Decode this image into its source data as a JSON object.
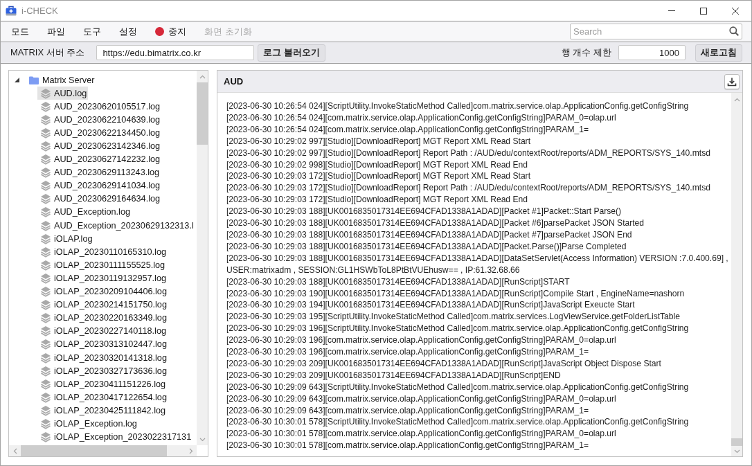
{
  "window": {
    "title": "i-CHECK"
  },
  "menu": [
    {
      "label": "모드",
      "kind": "menu",
      "disabled": false
    },
    {
      "label": "파일",
      "kind": "menu",
      "disabled": false
    },
    {
      "label": "도구",
      "kind": "menu",
      "disabled": false
    },
    {
      "label": "설정",
      "kind": "menu",
      "disabled": false
    },
    {
      "label": "중지",
      "kind": "action",
      "disabled": false
    },
    {
      "label": "화면 초기화",
      "kind": "menu",
      "disabled": true
    }
  ],
  "search": {
    "placeholder": "Search"
  },
  "toolbar": {
    "server_label": "MATRIX 서버 주소",
    "server_url": "https://edu.bimatrix.co.kr",
    "load_button": "로그 불러오기",
    "row_limit_label": "행 개수 제한",
    "row_limit": "1000",
    "refresh_button": "새로고침"
  },
  "tree": [
    {
      "label": "Matrix Server",
      "expanded": true,
      "selected": false,
      "children": [
        {
          "label": "AUD.log",
          "selected": true
        },
        {
          "label": "AUD_20230620105517.log",
          "selected": false
        },
        {
          "label": "AUD_20230622104639.log",
          "selected": false
        },
        {
          "label": "AUD_20230622134450.log",
          "selected": false
        },
        {
          "label": "AUD_20230623142346.log",
          "selected": false
        },
        {
          "label": "AUD_20230627142232.log",
          "selected": false
        },
        {
          "label": "AUD_20230629113243.log",
          "selected": false
        },
        {
          "label": "AUD_20230629141034.log",
          "selected": false
        },
        {
          "label": "AUD_20230629164634.log",
          "selected": false
        },
        {
          "label": "AUD_Exception.log",
          "selected": false
        },
        {
          "label": "AUD_Exception_20230629132313.l",
          "selected": false
        },
        {
          "label": "iOLAP.log",
          "selected": false
        },
        {
          "label": "iOLAP_20230110165310.log",
          "selected": false
        },
        {
          "label": "iOLAP_20230111155525.log",
          "selected": false
        },
        {
          "label": "iOLAP_20230119132957.log",
          "selected": false
        },
        {
          "label": "iOLAP_20230209104406.log",
          "selected": false
        },
        {
          "label": "iOLAP_20230214151750.log",
          "selected": false
        },
        {
          "label": "iOLAP_20230220163349.log",
          "selected": false
        },
        {
          "label": "iOLAP_20230227140118.log",
          "selected": false
        },
        {
          "label": "iOLAP_20230313102447.log",
          "selected": false
        },
        {
          "label": "iOLAP_20230320141318.log",
          "selected": false
        },
        {
          "label": "iOLAP_20230327173636.log",
          "selected": false
        },
        {
          "label": "iOLAP_20230411151226.log",
          "selected": false
        },
        {
          "label": "iOLAP_20230417122654.log",
          "selected": false
        },
        {
          "label": "iOLAP_20230425111842.log",
          "selected": false
        },
        {
          "label": "iOLAP_Exception.log",
          "selected": false
        },
        {
          "label": "iOLAP_Exception_2023022317131",
          "selected": false
        }
      ]
    }
  ],
  "log_panel": {
    "title": "AUD",
    "lines": [
      "[2023-06-30 10:26:54 024][ScriptUtility.InvokeStaticMethod Called]com.matrix.service.olap.ApplicationConfig.getConfigString",
      "[2023-06-30 10:26:54 024][com.matrix.service.olap.ApplicationConfig.getConfigString]PARAM_0=olap.url",
      "[2023-06-30 10:26:54 024][com.matrix.service.olap.ApplicationConfig.getConfigString]PARAM_1=",
      "[2023-06-30 10:29:02 997][Studio][DownloadReport] MGT Report XML Read Start",
      "[2023-06-30 10:29:02 997][Studio][DownloadReport] Report Path : /AUD/edu/contextRoot/reports/ADM_REPORTS/SYS_140.mtsd",
      "[2023-06-30 10:29:02 998][Studio][DownloadReport] MGT Report XML Read End",
      "[2023-06-30 10:29:03 172][Studio][DownloadReport] MGT Report XML Read Start",
      "[2023-06-30 10:29:03 172][Studio][DownloadReport] Report Path : /AUD/edu/contextRoot/reports/ADM_REPORTS/SYS_140.mtsd",
      "[2023-06-30 10:29:03 172][Studio][DownloadReport] MGT Report XML Read End",
      "[2023-06-30 10:29:03 188][UK0016835017314EE694CFAD1338A1ADAD][Packet #1]Packet::Start Parse()",
      "[2023-06-30 10:29:03 188][UK0016835017314EE694CFAD1338A1ADAD][Packet #6]parsePacket JSON Started",
      "[2023-06-30 10:29:03 188][UK0016835017314EE694CFAD1338A1ADAD][Packet #7]parsePacket JSON End",
      "[2023-06-30 10:29:03 188][UK0016835017314EE694CFAD1338A1ADAD][Packet.Parse()]Parse Completed",
      "[2023-06-30 10:29:03 188][UK0016835017314EE694CFAD1338A1ADAD][DataSetServlet(Access Information) VERSION :7.0.400.69] , USER:matrixadm , SESSION:GL1HSWbToL8PtBtVUEhusw== , IP:61.32.68.66",
      "[2023-06-30 10:29:03 188][UK0016835017314EE694CFAD1338A1ADAD][RunScript]START",
      "[2023-06-30 10:29:03 190][UK0016835017314EE694CFAD1338A1ADAD][RunScript]Compile Start , EngineName=nashorn",
      "[2023-06-30 10:29:03 194][UK0016835017314EE694CFAD1338A1ADAD][RunScript]JavaScript Exeucte Start",
      "[2023-06-30 10:29:03 195][ScriptUtility.InvokeStaticMethod Called]com.matrix.services.LogViewService.getFolderListTable",
      "[2023-06-30 10:29:03 196][ScriptUtility.InvokeStaticMethod Called]com.matrix.service.olap.ApplicationConfig.getConfigString",
      "[2023-06-30 10:29:03 196][com.matrix.service.olap.ApplicationConfig.getConfigString]PARAM_0=olap.url",
      "[2023-06-30 10:29:03 196][com.matrix.service.olap.ApplicationConfig.getConfigString]PARAM_1=",
      "[2023-06-30 10:29:03 209][UK0016835017314EE694CFAD1338A1ADAD][RunScript]JavaScript Object Dispose Start",
      "[2023-06-30 10:29:03 209][UK0016835017314EE694CFAD1338A1ADAD][RunScript]END",
      "[2023-06-30 10:29:09 643][ScriptUtility.InvokeStaticMethod Called]com.matrix.service.olap.ApplicationConfig.getConfigString",
      "[2023-06-30 10:29:09 643][com.matrix.service.olap.ApplicationConfig.getConfigString]PARAM_0=olap.url",
      "[2023-06-30 10:29:09 643][com.matrix.service.olap.ApplicationConfig.getConfigString]PARAM_1=",
      "[2023-06-30 10:30:01 578][ScriptUtility.InvokeStaticMethod Called]com.matrix.service.olap.ApplicationConfig.getConfigString",
      "[2023-06-30 10:30:01 578][com.matrix.service.olap.ApplicationConfig.getConfigString]PARAM_0=olap.url",
      "[2023-06-30 10:30:01 578][com.matrix.service.olap.ApplicationConfig.getConfigString]PARAM_1="
    ]
  }
}
